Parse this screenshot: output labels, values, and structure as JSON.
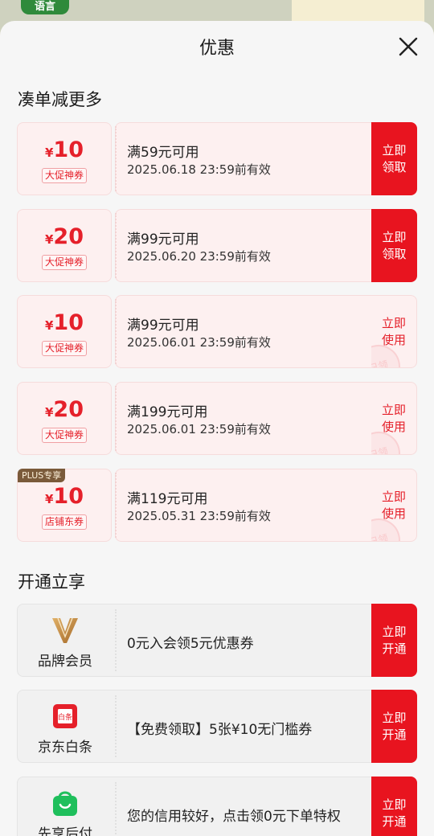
{
  "background": {
    "logo_text": "语言"
  },
  "header": {
    "title": "优惠"
  },
  "sections": {
    "coupons_title": "凑单减更多",
    "services_title": "开通立享"
  },
  "coupons": [
    {
      "currency": "¥",
      "amount": "10",
      "tag": "大促神券",
      "condition": "满59元可用",
      "validity": "2025.06.18 23:59前有效",
      "action": "立即\n领取",
      "state": "available"
    },
    {
      "currency": "¥",
      "amount": "20",
      "tag": "大促神券",
      "condition": "满99元可用",
      "validity": "2025.06.20 23:59前有效",
      "action": "立即\n领取",
      "state": "available"
    },
    {
      "currency": "¥",
      "amount": "10",
      "tag": "大促神券",
      "condition": "满99元可用",
      "validity": "2025.06.01 23:59前有效",
      "action": "立即\n使用",
      "state": "claimed",
      "stamp": "已领"
    },
    {
      "currency": "¥",
      "amount": "20",
      "tag": "大促神券",
      "condition": "满199元可用",
      "validity": "2025.06.01 23:59前有效",
      "action": "立即\n使用",
      "state": "claimed",
      "stamp": "已领"
    },
    {
      "currency": "¥",
      "amount": "10",
      "tag": "店铺东券",
      "badge": "PLUS专享",
      "condition": "满119元可用",
      "validity": "2025.05.31 23:59前有效",
      "action": "立即\n使用",
      "state": "claimed",
      "stamp": "已领"
    }
  ],
  "services": [
    {
      "icon": "brand-member-icon",
      "label": "品牌会员",
      "description": "0元入会领5元优惠券",
      "action": "立即\n开通"
    },
    {
      "icon": "jd-baitiao-icon",
      "label": "京东白条",
      "icon_text": "白条",
      "description": "【免费领取】5张¥10无门槛券",
      "action": "立即\n开通"
    },
    {
      "icon": "pay-later-bag-icon",
      "label": "先享后付",
      "description": "您的信用较好，点击领0元下单特权",
      "action": "立即\n开通"
    }
  ],
  "colors": {
    "accent": "#e8141f",
    "coupon_bg": "#fdf0f0",
    "service_bg": "#f1f1f1",
    "plus_badge": "#7a5a3a",
    "pay_later_green": "#1fbf5c"
  }
}
